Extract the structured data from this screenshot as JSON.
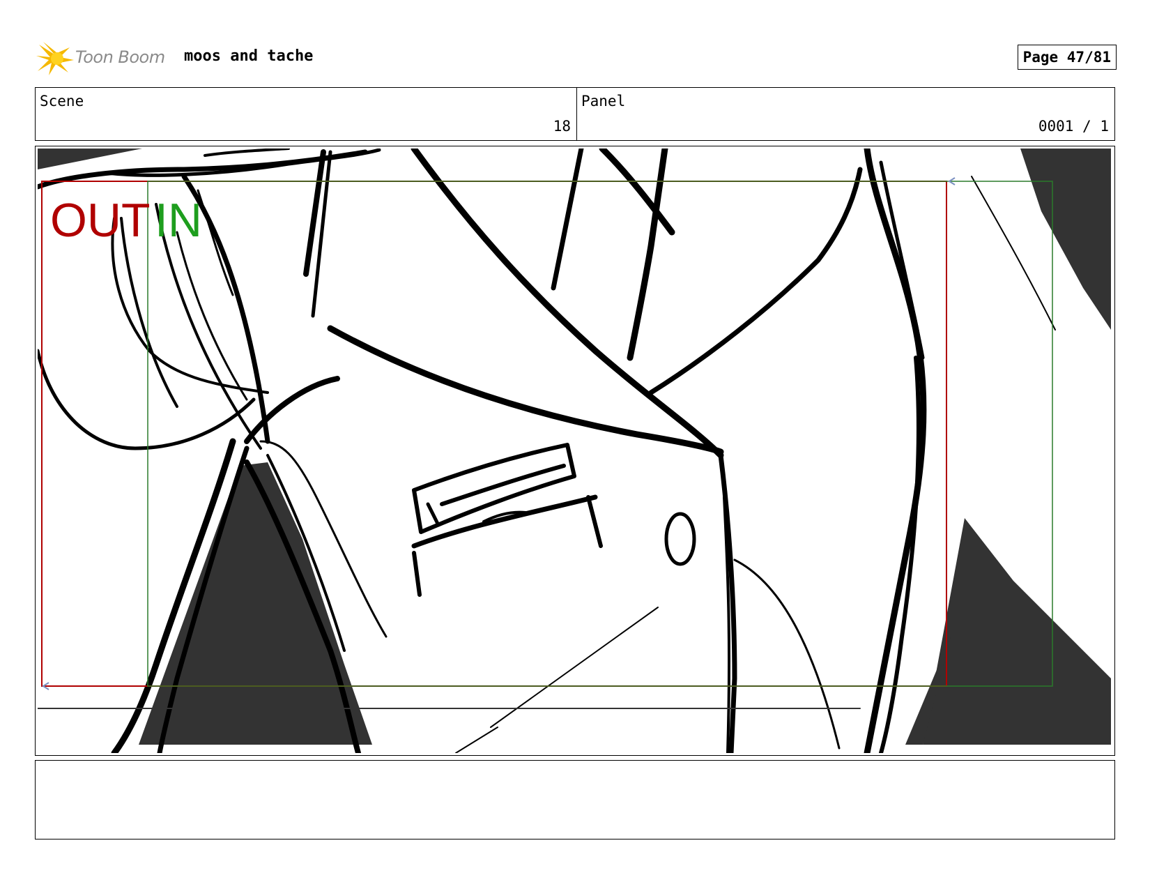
{
  "header": {
    "logo_text": "Toon Boom",
    "project_title": "moos and tache",
    "page_label": "Page 47/81"
  },
  "info": {
    "scene_label": "Scene",
    "scene_value": "18",
    "panel_label": "Panel",
    "panel_value": "0001 / 1"
  },
  "panel": {
    "out_label": "OUT",
    "in_label": "IN",
    "colors": {
      "out_frame": "#b00000",
      "in_frame": "#2a7a2a",
      "shadow_fill": "#333333",
      "ink": "#000000"
    }
  },
  "notes": {
    "text": ""
  }
}
